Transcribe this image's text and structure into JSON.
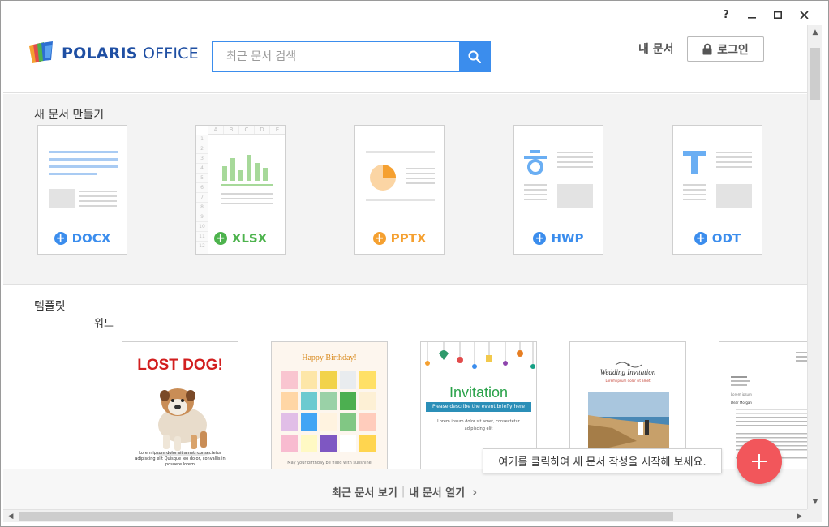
{
  "window": {
    "help": "?",
    "minimize": "–",
    "maximize": "□",
    "close": "✕"
  },
  "header": {
    "logo_brand": "POLARIS",
    "logo_suffix": "OFFICE",
    "search_placeholder": "최근 문서 검색",
    "my_docs_label": "내 문서",
    "login_label": "로그인"
  },
  "new_doc": {
    "title": "새 문서 만들기",
    "cards": [
      {
        "label": "DOCX",
        "color": "#3b8ded"
      },
      {
        "label": "XLSX",
        "color": "#4db34d"
      },
      {
        "label": "PPTX",
        "color": "#f5a030"
      },
      {
        "label": "HWP",
        "color": "#3b8ded"
      },
      {
        "label": "ODT",
        "color": "#3b8ded"
      }
    ],
    "xlsx_cols": [
      "A",
      "B",
      "C",
      "D",
      "E"
    ],
    "xlsx_rows": [
      "1",
      "2",
      "3",
      "4",
      "5",
      "6",
      "7",
      "8",
      "9",
      "10",
      "11",
      "12"
    ]
  },
  "templates": {
    "title": "템플릿",
    "category": "워드",
    "items": [
      {
        "heading": "LOST DOG!",
        "caption": "Lorem ipsum dolor sit amet, consectetur adipiscing elit Quisque leo dolor, convallis in posuere lorem"
      },
      {
        "heading": "Happy Birthday!",
        "caption": "May your birthday be filled with sunshine"
      },
      {
        "heading": "Invitation",
        "subheading": "Please describe the event briefly here",
        "caption": "Lorem ipsum dolor sit amet, consectetur adipiscing elit"
      },
      {
        "heading": "Wedding Invitation",
        "caption": "Lorem ipsum dolor sit amet"
      },
      {
        "heading": "Dear Morgan",
        "caption": "Lorem ipsum"
      }
    ]
  },
  "bottom": {
    "recent_docs": "최근 문서 보기",
    "separator": "|",
    "open_my_docs": "내 문서 열기",
    "chevron": "›"
  },
  "tooltip": {
    "text": "여기를 클릭하여 새 문서 작성을 시작해 보세요."
  },
  "colors": {
    "accent": "#3b8ded",
    "fab": "#f2565b",
    "logo": "#1f4fa3"
  }
}
